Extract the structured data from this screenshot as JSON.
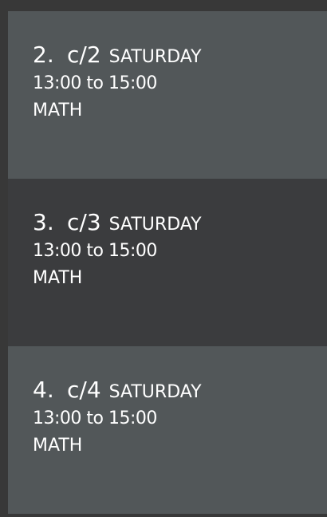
{
  "colors": {
    "background": "#383838",
    "card_light": "#525759",
    "card_dark": "#3b3c3e",
    "text": "#ffffff"
  },
  "cards": [
    {
      "index": "2.",
      "code": "c/2",
      "day": "SATURDAY",
      "time": "13:00 to 15:00",
      "subject": "MATH"
    },
    {
      "index": "3.",
      "code": "c/3",
      "day": "SATURDAY",
      "time": "13:00 to 15:00",
      "subject": "MATH"
    },
    {
      "index": "4.",
      "code": "c/4",
      "day": "SATURDAY",
      "time": "13:00 to 15:00",
      "subject": "MATH"
    }
  ]
}
